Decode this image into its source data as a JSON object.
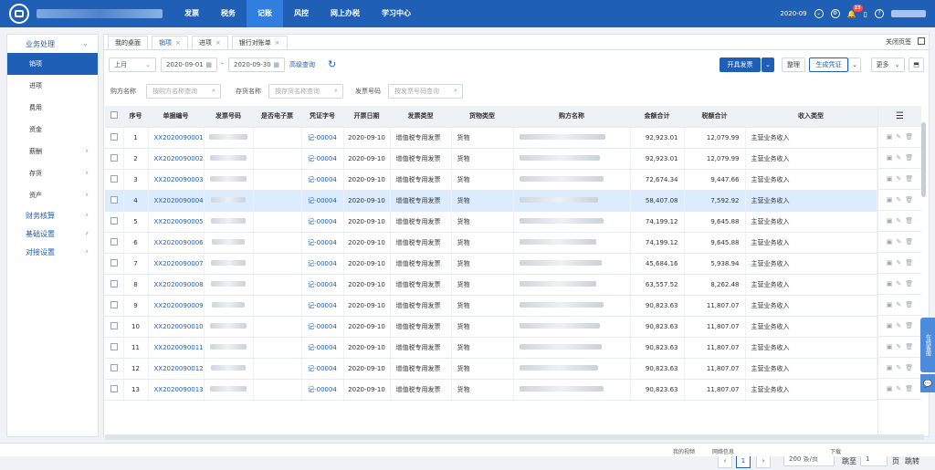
{
  "app": {
    "title": "",
    "period": "2020-09",
    "notification_count": "23"
  },
  "nav": [
    "发票",
    "税务",
    "记账",
    "风控",
    "网上办税",
    "学习中心"
  ],
  "sidebar": {
    "groups": [
      {
        "label": "业务处理",
        "items": [
          "销项",
          "进项",
          "费用",
          "资金",
          "薪酬",
          "存货",
          "资产"
        ]
      },
      {
        "label": "财务核算"
      },
      {
        "label": "基础设置"
      },
      {
        "label": "对接设置"
      }
    ]
  },
  "tabs": [
    "我的桌面",
    "销项",
    "进项",
    "银行对账单"
  ],
  "close_pages": "关闭页签",
  "toolbar": {
    "month": "上月",
    "date_from": "2020-09-01",
    "date_to": "2020-09-30",
    "advanced": "高级查询",
    "generate_invoice": "开具发票",
    "organize": "整理",
    "generate_voucher": "生成凭证",
    "more": "更多"
  },
  "filters": {
    "buyer_label": "购方名称",
    "buyer_placeholder": "按购方名称查询",
    "inventory_label": "存货名称",
    "inventory_placeholder": "按存货名称查询",
    "invoice_label": "发票号码",
    "invoice_placeholder": "按发票号码查询"
  },
  "table": {
    "headers": [
      "序号",
      "单据编号",
      "发票号码",
      "是否电子票",
      "凭证字号",
      "开票日期",
      "发票类型",
      "货物类型",
      "购方名称",
      "金额合计",
      "税额合计",
      "收入类型"
    ],
    "rows": [
      {
        "no": "1",
        "doc": "XX2020090001",
        "voucher": "记-00004",
        "date": "2020-09-10",
        "type": "增值税专用发票",
        "goods": "货物",
        "amount": "92,923.01",
        "tax": "12,079.99",
        "income": "主营业务收入"
      },
      {
        "no": "2",
        "doc": "XX2020090002",
        "voucher": "记-00004",
        "date": "2020-09-10",
        "type": "增值税专用发票",
        "goods": "货物",
        "amount": "92,923.01",
        "tax": "12,079.99",
        "income": "主营业务收入"
      },
      {
        "no": "3",
        "doc": "XX2020090003",
        "voucher": "记-00004",
        "date": "2020-09-10",
        "type": "增值税专用发票",
        "goods": "货物",
        "amount": "72,674.34",
        "tax": "9,447.66",
        "income": "主营业务收入"
      },
      {
        "no": "4",
        "doc": "XX2020090004",
        "voucher": "记-00004",
        "date": "2020-09-10",
        "type": "增值税专用发票",
        "goods": "货物",
        "amount": "58,407.08",
        "tax": "7,592.92",
        "income": "主营业务收入"
      },
      {
        "no": "5",
        "doc": "XX2020090005",
        "voucher": "记-00004",
        "date": "2020-09-10",
        "type": "增值税专用发票",
        "goods": "货物",
        "amount": "74,199.12",
        "tax": "9,645.88",
        "income": "主营业务收入"
      },
      {
        "no": "6",
        "doc": "XX2020090006",
        "voucher": "记-00004",
        "date": "2020-09-10",
        "type": "增值税专用发票",
        "goods": "货物",
        "amount": "74,199.12",
        "tax": "9,645.88",
        "income": "主营业务收入"
      },
      {
        "no": "7",
        "doc": "XX2020090007",
        "voucher": "记-00004",
        "date": "2020-09-10",
        "type": "增值税专用发票",
        "goods": "货物",
        "amount": "45,684.16",
        "tax": "5,938.94",
        "income": "主营业务收入"
      },
      {
        "no": "8",
        "doc": "XX2020090008",
        "voucher": "记-00004",
        "date": "2020-09-10",
        "type": "增值税专用发票",
        "goods": "货物",
        "amount": "63,557.52",
        "tax": "8,262.48",
        "income": "主营业务收入"
      },
      {
        "no": "9",
        "doc": "XX2020090009",
        "voucher": "记-00004",
        "date": "2020-09-10",
        "type": "增值税专用发票",
        "goods": "货物",
        "amount": "90,823.63",
        "tax": "11,807.07",
        "income": "主营业务收入"
      },
      {
        "no": "10",
        "doc": "XX2020090010",
        "voucher": "记-00004",
        "date": "2020-09-10",
        "type": "增值税专用发票",
        "goods": "货物",
        "amount": "90,823.63",
        "tax": "11,807.07",
        "income": "主营业务收入"
      },
      {
        "no": "11",
        "doc": "XX2020090011",
        "voucher": "记-00004",
        "date": "2020-09-10",
        "type": "增值税专用发票",
        "goods": "货物",
        "amount": "90,823.63",
        "tax": "11,807.07",
        "income": "主营业务收入"
      },
      {
        "no": "12",
        "doc": "XX2020090012",
        "voucher": "记-00004",
        "date": "2020-09-10",
        "type": "增值税专用发票",
        "goods": "货物",
        "amount": "90,823.63",
        "tax": "11,807.07",
        "income": "主营业务收入"
      },
      {
        "no": "13",
        "doc": "XX2020090013",
        "voucher": "记-00004",
        "date": "2020-09-10",
        "type": "增值税专用发票",
        "goods": "货物",
        "amount": "90,823.63",
        "tax": "11,807.07",
        "income": "主营业务收入"
      }
    ]
  },
  "pager": {
    "current": "1",
    "page_size": "200 条/页",
    "jump_label": "跳至",
    "jump_value": "1",
    "page_suffix": "页",
    "jump_button": "跳转"
  },
  "floating": {
    "online": "在线客服"
  },
  "status": {
    "left1": "我的视频",
    "left2": "网络信息",
    "download": "下载"
  }
}
